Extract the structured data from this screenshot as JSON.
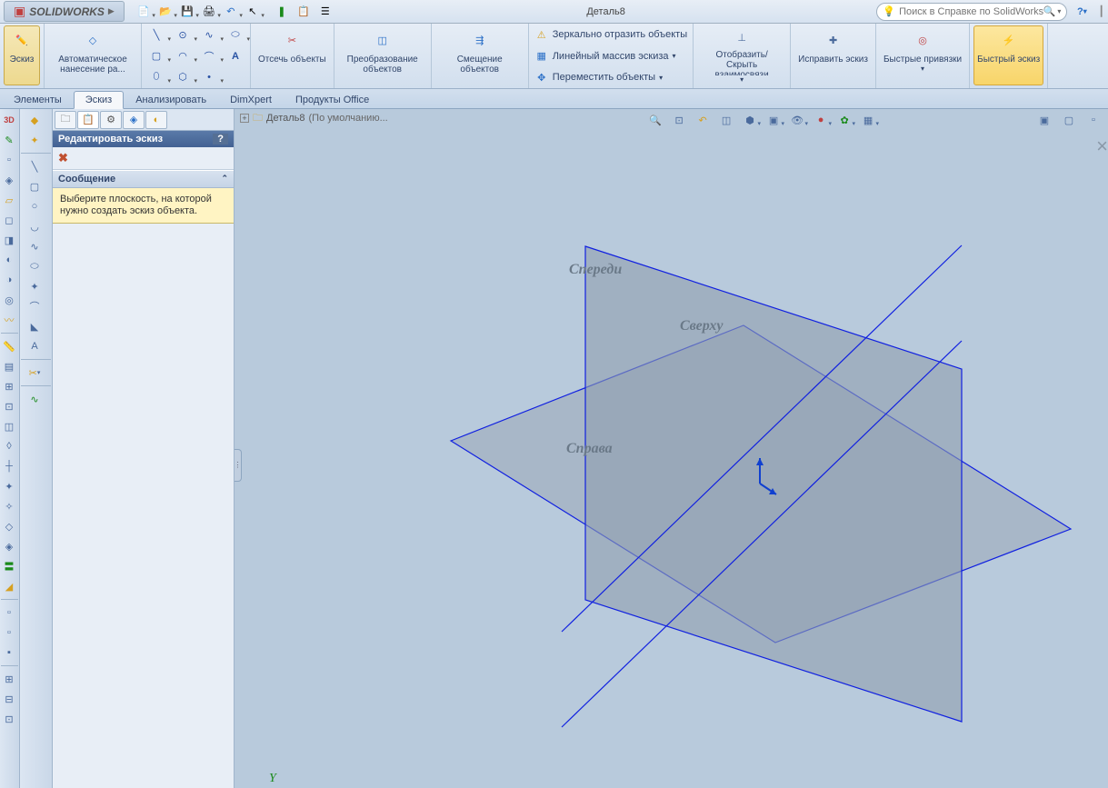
{
  "app": {
    "name": "SOLIDWORKS",
    "doc_title": "Деталь8"
  },
  "search": {
    "placeholder": "Поиск в Справке по SolidWorks"
  },
  "qat": [
    "new",
    "open",
    "save",
    "print",
    "undo",
    "select",
    "rebuild",
    "options",
    "list"
  ],
  "ribbon": {
    "sketch_btn": "Эскиз",
    "auto_dim": "Автоматическое нанесение ра...",
    "trim": "Отсечь объекты",
    "convert": "Преобразование объектов",
    "offset": "Смещение объектов",
    "mirror": "Зеркально отразить объекты",
    "linear": "Линейный массив эскиза",
    "move": "Переместить объекты",
    "display_rel": "Отобразить/Скрыть взаимосвязи",
    "repair": "Исправить эскиз",
    "quick_snaps": "Быстрые привязки",
    "rapid_sketch": "Быстрый эскиз"
  },
  "tabs": {
    "t1": "Элементы",
    "t2": "Эскиз",
    "t3": "Анализировать",
    "t4": "DimXpert",
    "t5": "Продукты Office"
  },
  "pp": {
    "title": "Редактировать эскиз",
    "help": "?",
    "section_title": "Сообщение",
    "message": "Выберите плоскость, на которой нужно создать эскиз объекта."
  },
  "breadcrumb": {
    "part": "Деталь8",
    "config": "(По умолчанию..."
  },
  "planes": {
    "front": "Спереди",
    "top": "Сверху",
    "right": "Справа"
  },
  "axis_y": "Y"
}
